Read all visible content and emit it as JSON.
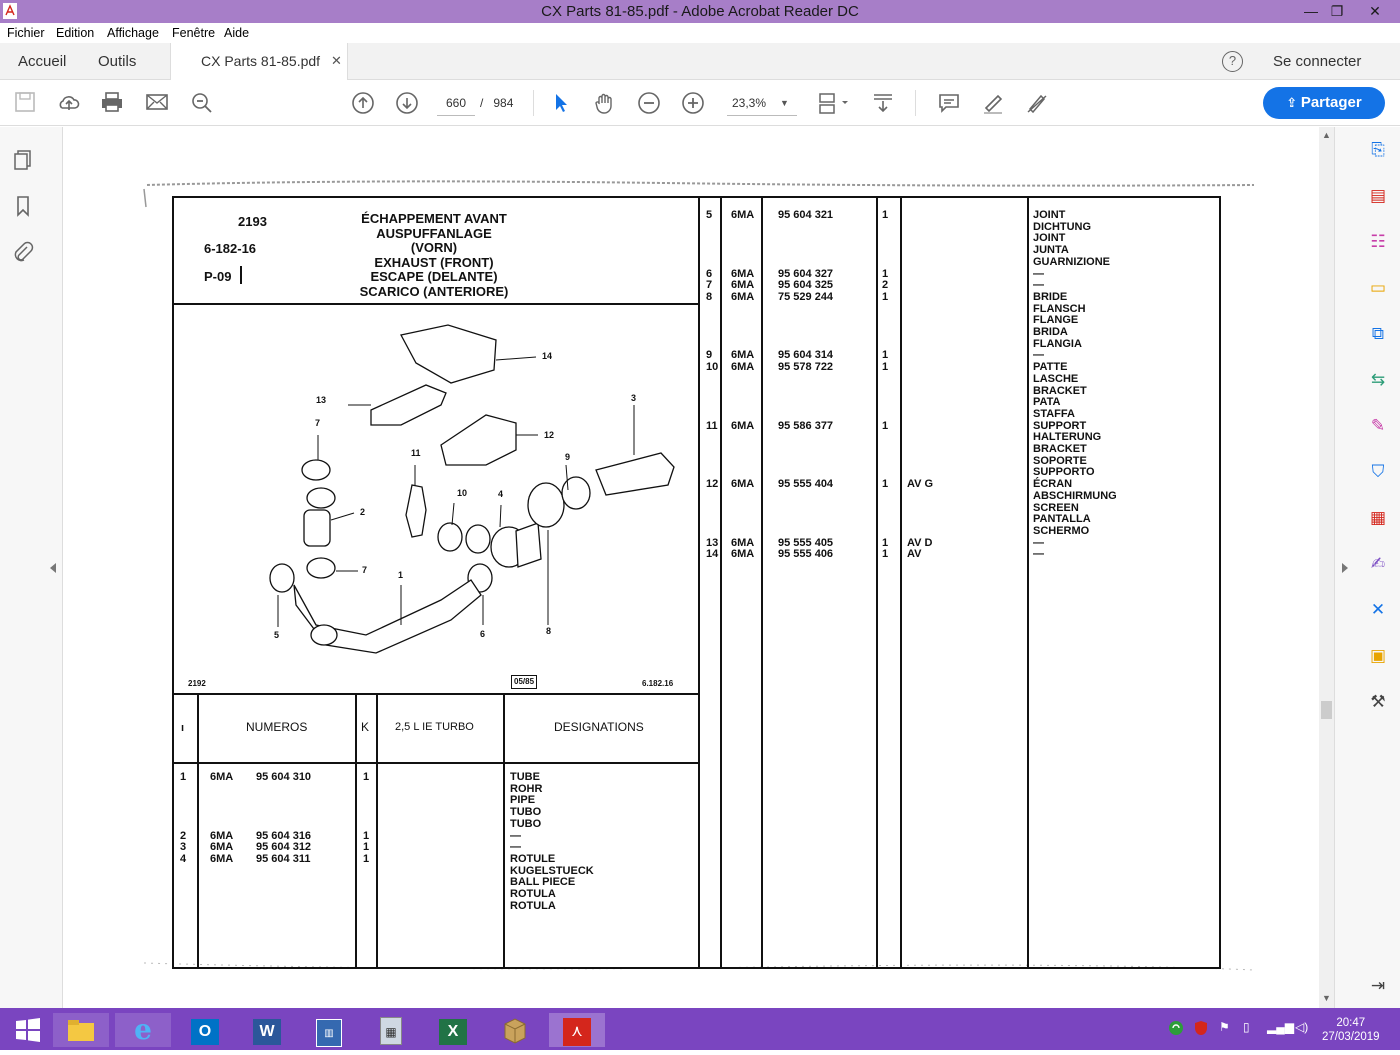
{
  "window": {
    "title": "CX Parts 81-85.pdf - Adobe Acrobat Reader DC",
    "minimize": "—",
    "maximize": "❐",
    "close": "✕"
  },
  "menu": [
    "Fichier",
    "Edition",
    "Affichage",
    "Fenêtre",
    "Aide"
  ],
  "tabs": {
    "home": "Accueil",
    "tools": "Outils",
    "doc": "CX Parts 81-85.pdf",
    "close": "✕",
    "help": "?",
    "signin": "Se connecter"
  },
  "toolbar": {
    "page_current": "660",
    "page_sep": "/",
    "page_total": "984",
    "zoom": "23,3%",
    "share": "Partager"
  },
  "sheet": {
    "ref": "2193",
    "code": "6-182-16",
    "pos": "P-09",
    "title_lines": [
      "ÉCHAPPEMENT AVANT",
      "AUSPUFFANLAGE (VORN)",
      "EXHAUST (FRONT)",
      "ESCAPE (DELANTE)",
      "SCARICO (ANTERIORE)"
    ],
    "footer_left": "2192",
    "footer_mid": "05/85",
    "footer_right": "6.182.16",
    "col_headers": {
      "numeros": "NUMEROS",
      "k": "K",
      "turbo": "2,5 L IE TURBO",
      "designations": "DESIGNATIONS"
    },
    "callouts": [
      "14",
      "13",
      "3",
      "7",
      "12",
      "11",
      "9",
      "10",
      "4",
      "2",
      "7",
      "1",
      "5",
      "6",
      "8"
    ],
    "left_rows": {
      "idx": "1\n\n\n\n\n2\n3\n4",
      "mod": "6MA\n\n\n\n\n6MA\n6MA\n6MA",
      "num": "95 604 310\n\n\n\n\n95 604 316\n95 604 312\n95 604 311",
      "k": "1\n\n\n\n\n1\n1\n1",
      "desig": "TUBE\nROHR\nPIPE\nTUBO\nTUBO\n—\n—\nROTULE\nKUGELSTUECK\nBALL PIECE\nROTULA\nROTULA"
    },
    "right_rows": {
      "idx": "5\n\n\n\n\n6\n7\n8\n\n\n\n\n9\n10\n\n\n\n\n11\n\n\n\n\n12\n\n\n\n\n13\n14",
      "mod": "6MA\n\n\n\n\n6MA\n6MA\n6MA\n\n\n\n\n6MA\n6MA\n\n\n\n\n6MA\n\n\n\n\n6MA\n\n\n\n\n6MA\n6MA",
      "num": "95 604 321\n\n\n\n\n95 604 327\n95 604 325\n75 529 244\n\n\n\n\n95 604 314\n95 578 722\n\n\n\n\n95 586 377\n\n\n\n\n95 555 404\n\n\n\n\n95 555 405\n95 555 406",
      "k": "1\n\n\n\n\n1\n2\n1\n\n\n\n\n1\n1\n\n\n\n\n1\n\n\n\n\n1\n\n\n\n\n1\n1",
      "turbo": "\n\n\n\n\n\n\n\n\n\n\n\n\n\n\n\n\n\n\n\n\n\n\nAV G\n\n\n\n\nAV D\nAV",
      "desig": "JOINT\nDICHTUNG\nJOINT\nJUNTA\nGUARNIZIONE\n—\n—\nBRIDE\nFLANSCH\nFLANGE\nBRIDA\nFLANGIA\n—\nPATTE\nLASCHE\nBRACKET\nPATA\nSTAFFA\nSUPPORT\nHALTERUNG\nBRACKET\nSOPORTE\nSUPPORTO\nÉCRAN\nABSCHIRMUNG\nSCREEN\nPANTALLA\nSCHERMO\n—\n—"
    }
  },
  "taskbar": {
    "time": "20:47",
    "date": "27/03/2019"
  }
}
